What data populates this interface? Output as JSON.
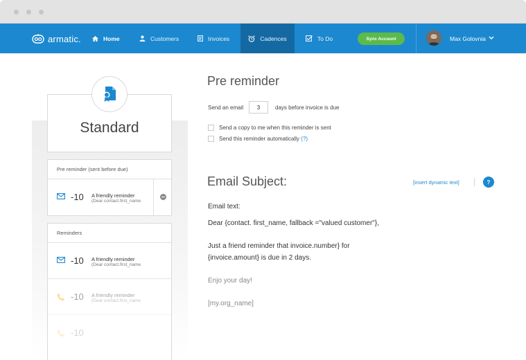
{
  "brand": {
    "name": "armatic."
  },
  "nav": {
    "items": [
      {
        "label": "Home",
        "icon": "home-icon"
      },
      {
        "label": "Customers",
        "icon": "user-icon"
      },
      {
        "label": "Invoices",
        "icon": "invoice-icon"
      },
      {
        "label": "Cadences",
        "icon": "alarm-clock-icon"
      },
      {
        "label": "To Do",
        "icon": "checkbox-icon"
      }
    ],
    "sync_label": "Sync Account",
    "user_name": "Max Golovnia"
  },
  "cadence": {
    "title": "Standard"
  },
  "pre_section": {
    "header": "Pre reminder (sent before due)",
    "items": [
      {
        "days": "-10",
        "title": "A friendly reminder",
        "subtitle": "(Dear contact.first_name"
      }
    ]
  },
  "reminders_section": {
    "header": "Reminders",
    "items": [
      {
        "days": "-10",
        "title": "A friendly reminder",
        "subtitle": "(Dear contact.first_name",
        "icon": "email-icon"
      },
      {
        "days": "-10",
        "title": "A friendly reminder",
        "subtitle": "(Dear contact.first_name",
        "icon": "phone-icon"
      },
      {
        "days": "-10",
        "title": "",
        "subtitle": "",
        "icon": "phone-icon"
      }
    ]
  },
  "editor": {
    "heading": "Pre reminder",
    "send_label": "Send an email",
    "days_value": "3",
    "days_suffix": "days before invoice is due",
    "copy_label": "Send a copy to me when this reminder is sent",
    "auto_label": "Send this reminder automatically",
    "auto_help": "(?)",
    "subject_heading": "Email Subject:",
    "insert_link": "[insert dynamic text]",
    "help": "?",
    "email_text_label": "Email text:",
    "body": [
      "Dear {contact. first_name, fallback =\"valued customer\"},",
      "Just a friend reminder that invoice.number} for",
      "{invoice.amount} is due in 2 days.",
      "Enjo your day!",
      "[my.org_name]"
    ]
  },
  "colors": {
    "brand": "#1c88cf",
    "nav_active": "#1569a3",
    "sync": "#5bbb4a",
    "phone_icon": "#f0b400"
  }
}
